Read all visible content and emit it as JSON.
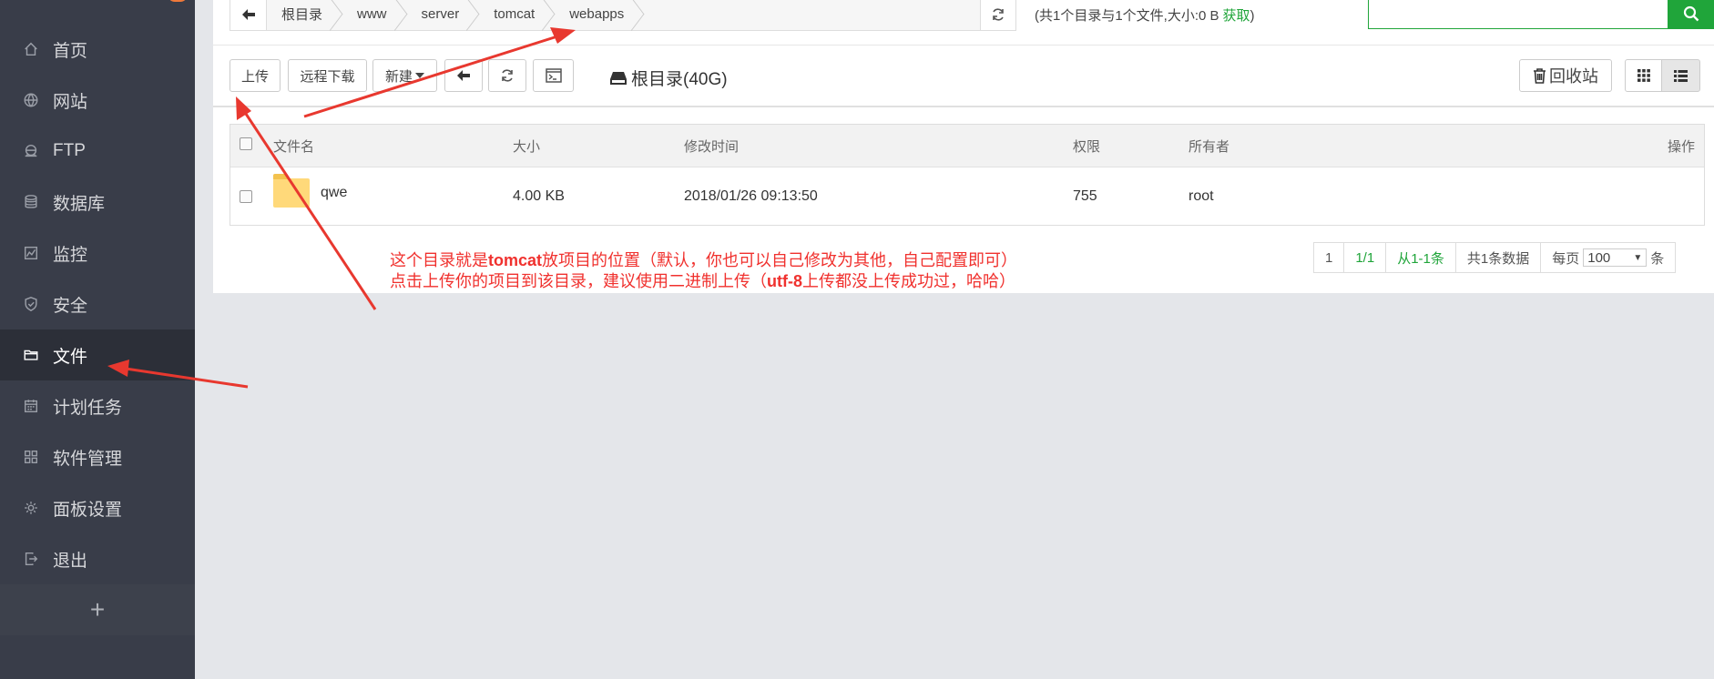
{
  "sidebar": {
    "items": [
      {
        "label": "首页",
        "icon": "home-icon"
      },
      {
        "label": "网站",
        "icon": "globe-icon"
      },
      {
        "label": "FTP",
        "icon": "ftp-icon"
      },
      {
        "label": "数据库",
        "icon": "database-icon"
      },
      {
        "label": "监控",
        "icon": "monitor-icon"
      },
      {
        "label": "安全",
        "icon": "shield-icon"
      },
      {
        "label": "文件",
        "icon": "folder-icon",
        "active": true
      },
      {
        "label": "计划任务",
        "icon": "calendar-icon"
      },
      {
        "label": "软件管理",
        "icon": "apps-icon"
      },
      {
        "label": "面板设置",
        "icon": "gear-icon"
      },
      {
        "label": "退出",
        "icon": "logout-icon"
      }
    ],
    "add_label": "+"
  },
  "path_bar": {
    "crumbs": [
      "根目录",
      "www",
      "server",
      "tomcat",
      "webapps"
    ],
    "info": "(共1个目录与1个文件,大小:0 B",
    "info_link": "获取",
    "info_close": ")"
  },
  "toolbar": {
    "upload": "上传",
    "remote_download": "远程下载",
    "new": "新建",
    "disk_label": "根目录(40G)",
    "recycle": "回收站"
  },
  "table": {
    "headers": {
      "name": "文件名",
      "size": "大小",
      "mtime": "修改时间",
      "perm": "权限",
      "owner": "所有者",
      "ops": "操作"
    },
    "rows": [
      {
        "name": "qwe",
        "size": "4.00 KB",
        "mtime": "2018/01/26 09:13:50",
        "perm": "755",
        "owner": "root"
      }
    ]
  },
  "annotation": {
    "line1_a": "这个目录就是",
    "line1_b": "tomcat",
    "line1_c": "放项目的位置（默认，你也可以自己修改为其他，自己配置即可）",
    "line2_a": "点击上传你的项目到该目录，建议使用二进制上传（",
    "line2_b": "utf-8",
    "line2_c": "上传都没上传成功过，哈哈）"
  },
  "pager": {
    "page": "1",
    "pages": "1/1",
    "range": "从1-1条",
    "total": "共1条数据",
    "per_page_label": "每页",
    "per_page_value": "100",
    "unit": "条"
  },
  "colors": {
    "accent": "#20a53a",
    "sidebar_bg": "#393d49",
    "annotation": "#f0312e"
  }
}
